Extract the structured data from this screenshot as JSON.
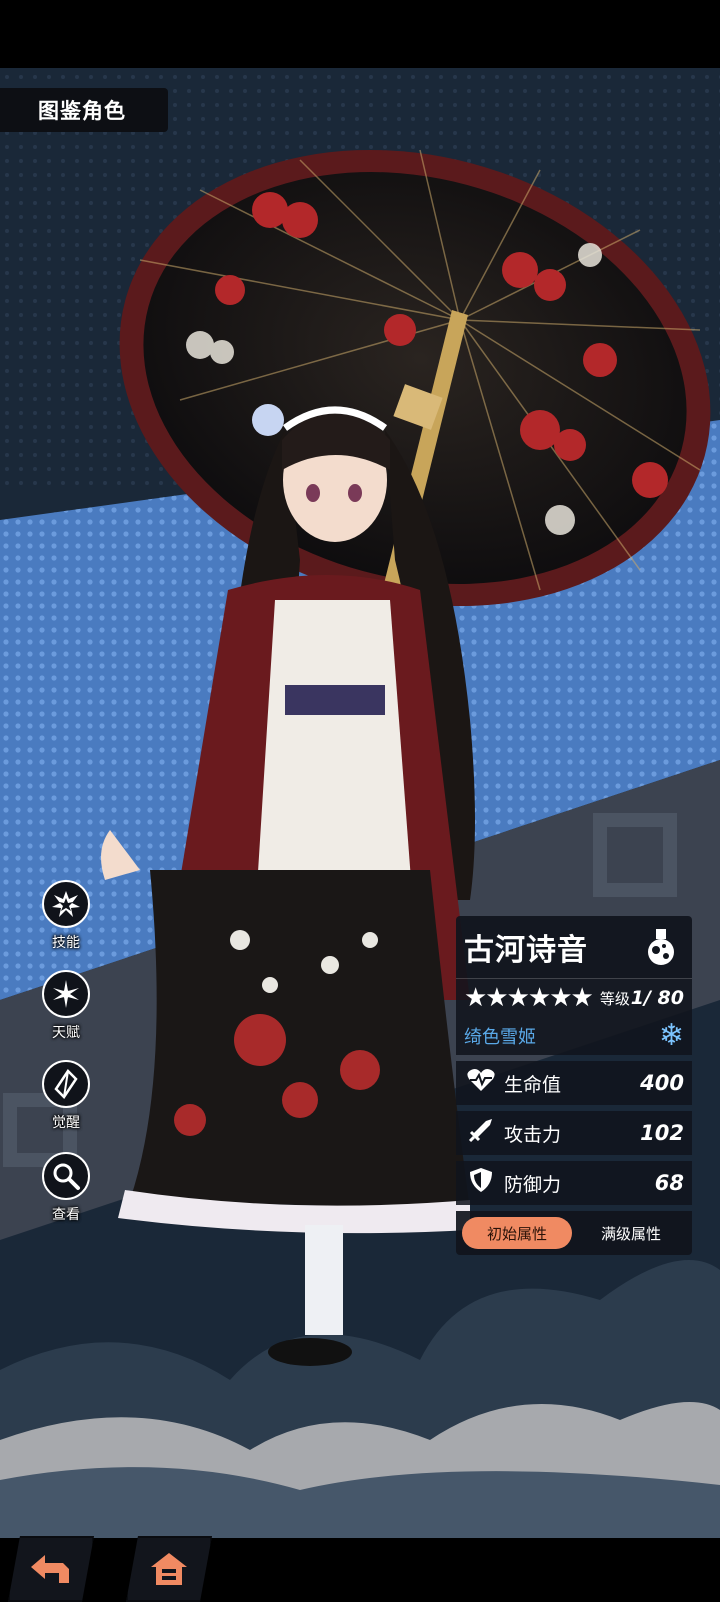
{
  "header": {
    "title": "图鉴角色"
  },
  "side_menu": [
    {
      "label": "技能",
      "icon": "explosion-icon"
    },
    {
      "label": "天赋",
      "icon": "star-burst-icon"
    },
    {
      "label": "觉醒",
      "icon": "crystal-icon"
    },
    {
      "label": "查看",
      "icon": "magnifier-icon"
    }
  ],
  "character": {
    "name": "古河诗音",
    "stars": "★★★★★★",
    "star_count": 6,
    "level_label": "等级",
    "level_value": "1/ 80",
    "title": "绮色雪姬",
    "element_icon": "snowflake-icon",
    "class_icon": "potion-flask-icon",
    "stats": [
      {
        "label": "生命值",
        "value": "400",
        "icon": "heart-pulse-icon"
      },
      {
        "label": "攻击力",
        "value": "102",
        "icon": "sword-icon"
      },
      {
        "label": "防御力",
        "value": "68",
        "icon": "shield-icon"
      }
    ],
    "tabs": [
      {
        "label": "初始属性",
        "active": true
      },
      {
        "label": "满级属性",
        "active": false
      }
    ]
  },
  "nav": {
    "back_icon": "back-arrow-icon",
    "home_icon": "home-icon"
  },
  "colors": {
    "accent": "#f08a62",
    "subtitle": "#5aa9e8",
    "panel": "#10141c",
    "bg_blue": "#4a7bc0",
    "bg_navy": "#1b2a3c"
  }
}
